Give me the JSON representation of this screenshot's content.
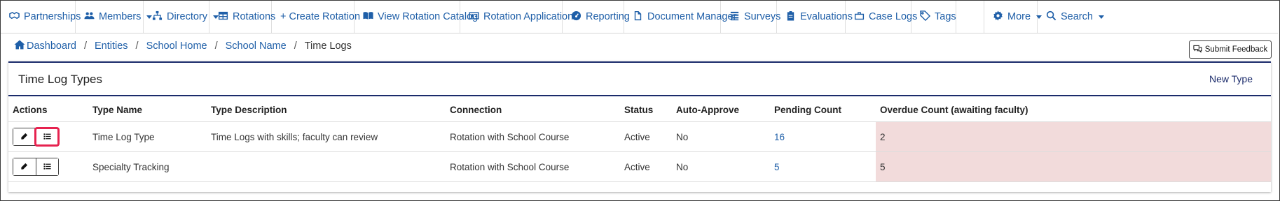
{
  "nav": {
    "partnerships": "Partnerships",
    "members": "Members",
    "directory": "Directory",
    "rotations": "Rotations",
    "create_rotation": "+ Create Rotation",
    "view_rotation_catalog": "View Rotation Catalog",
    "rotation_applications": "Rotation Applications",
    "reporting": "Reporting",
    "document_manager": "Document Manager",
    "surveys": "Surveys",
    "evaluations": "Evaluations",
    "case_logs": "Case Logs",
    "tags": "Tags",
    "more": "More",
    "search": "Search"
  },
  "breadcrumb": {
    "dashboard": "Dashboard",
    "entities": "Entities",
    "school_home": "School Home",
    "school_name": "School Name",
    "current": "Time Logs",
    "separator": "/"
  },
  "feedback_button": "Submit Feedback",
  "panel": {
    "title": "Time Log Types",
    "new_type": "New Type"
  },
  "table": {
    "headers": {
      "actions": "Actions",
      "type_name": "Type Name",
      "type_description": "Type Description",
      "connection": "Connection",
      "status": "Status",
      "auto_approve": "Auto-Approve",
      "pending_count": "Pending Count",
      "overdue_count": "Overdue Count (awaiting faculty)"
    },
    "rows": [
      {
        "type_name": "Time Log Type",
        "type_description": "Time Logs with skills; faculty can review",
        "connection": "Rotation with School Course",
        "status": "Active",
        "auto_approve": "No",
        "pending_count": "16",
        "overdue_count": "2"
      },
      {
        "type_name": "Specialty Tracking",
        "type_description": "",
        "connection": "Rotation with School Course",
        "status": "Active",
        "auto_approve": "No",
        "pending_count": "5",
        "overdue_count": "5"
      }
    ]
  },
  "colors": {
    "link": "#1f5fa8",
    "panel_border": "#1b2b6b",
    "overdue_bg": "#f2dbdb",
    "highlight": "#e6224f"
  }
}
